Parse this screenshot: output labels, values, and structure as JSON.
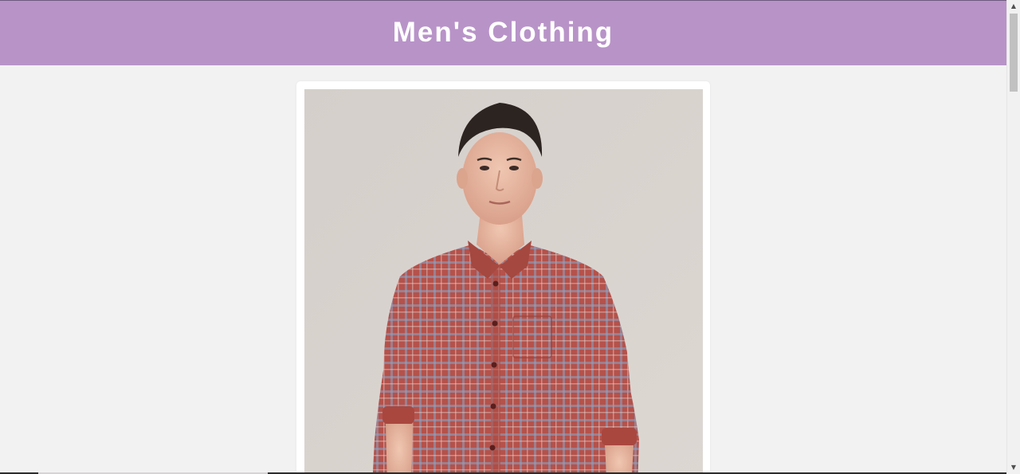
{
  "header": {
    "title": "Men's Clothing"
  },
  "product": {
    "image_icon": "product-photo-red-checked-shirt"
  },
  "colors": {
    "header_bg": "#b893c8",
    "page_bg": "#f3f2f2",
    "card_bg": "#ffffff",
    "shirt_red": "#b4524b",
    "check_blue": "#8aa4c4"
  },
  "scrollbar": {
    "up_arrow": "▲",
    "down_arrow": "▼"
  }
}
